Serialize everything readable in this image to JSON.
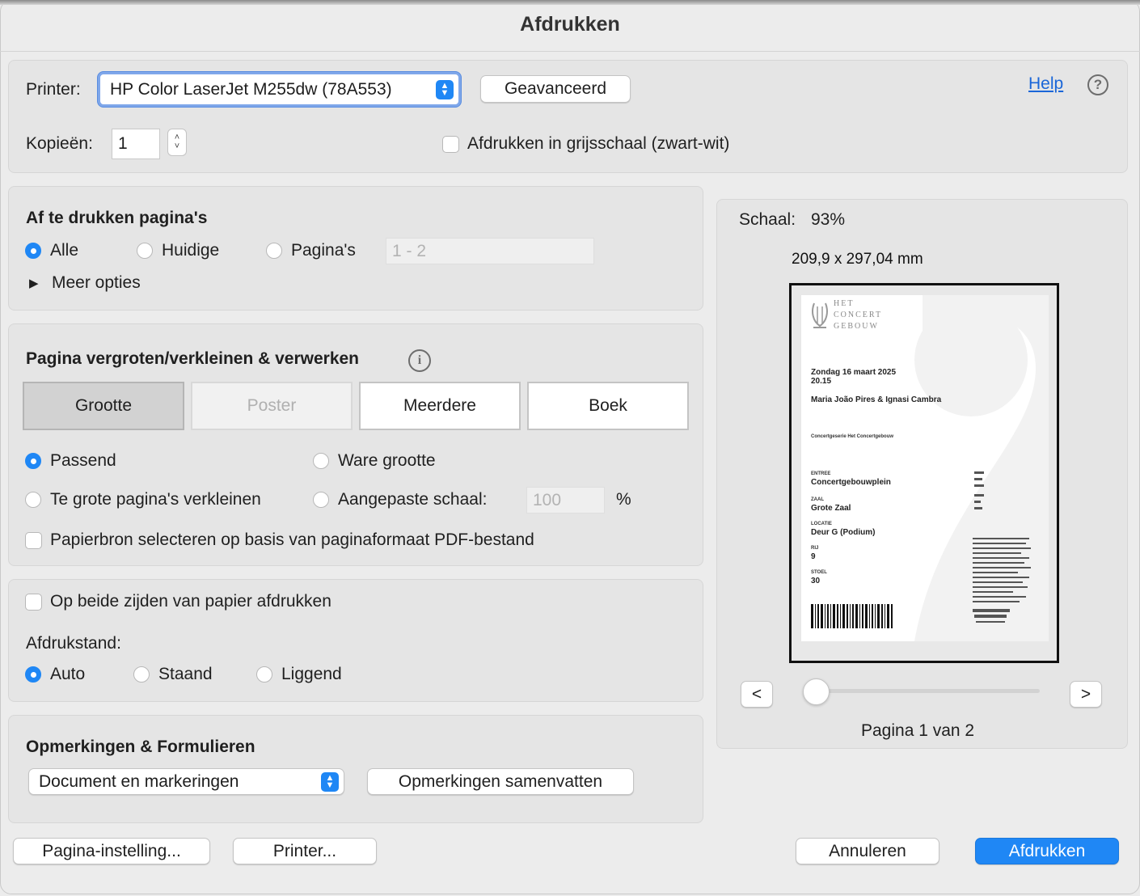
{
  "window": {
    "title": "Afdrukken"
  },
  "printer": {
    "label": "Printer:",
    "selected": "HP Color LaserJet M255dw (78A553)",
    "advanced_button": "Geavanceerd",
    "help_link": "Help",
    "help_icon": "?"
  },
  "copies": {
    "label": "Kopieën:",
    "value": "1",
    "grayscale_label": "Afdrukken in grijsschaal (zwart-wit)",
    "grayscale_checked": false
  },
  "pages": {
    "heading": "Af te drukken pagina's",
    "options": [
      "Alle",
      "Huidige",
      "Pagina's"
    ],
    "selected": "Alle",
    "range_placeholder": "1 - 2",
    "more_options": "Meer opties"
  },
  "sizing": {
    "heading": "Pagina vergroten/verkleinen & verwerken",
    "tabs": [
      "Grootte",
      "Poster",
      "Meerdere",
      "Boek"
    ],
    "active_tab": "Grootte",
    "disabled_tab": "Poster",
    "fit_label": "Passend",
    "actual_size_label": "Ware grootte",
    "shrink_label": "Te grote pagina's verkleinen",
    "custom_scale_label": "Aangepaste schaal:",
    "custom_scale_value": "100",
    "percent_symbol": "%",
    "selected": "Passend",
    "paper_source_label": "Papierbron selecteren op basis van paginaformaat PDF-bestand",
    "paper_source_checked": false
  },
  "duplex": {
    "label": "Op beide zijden van papier afdrukken",
    "checked": false,
    "orientation_label": "Afdrukstand:",
    "orientation_options": [
      "Auto",
      "Staand",
      "Liggend"
    ],
    "orientation_selected": "Auto"
  },
  "comments": {
    "heading": "Opmerkingen & Formulieren",
    "selected": "Document en markeringen",
    "summarize_button": "Opmerkingen samenvatten"
  },
  "preview": {
    "scale_label": "Schaal:",
    "scale_value": "93%",
    "dimensions": "209,9 x 297,04 mm",
    "prev_button": "<",
    "next_button": ">",
    "page_indicator": "Pagina 1 van 2",
    "page_slider_fraction": 0.0,
    "ticket": {
      "logo_lines": [
        "HET",
        "CONCERT",
        "GEBOUW"
      ],
      "date": "Zondag 16 maart 2025",
      "time": "20.15",
      "performers": "Maria João Pires & Ignasi Cambra",
      "series": "Concertgeserie Het Concertgebouw",
      "entry_label": "ENTREE",
      "entry_value": "Concertgebouwplein",
      "hall_label": "ZAAL",
      "hall_value": "Grote Zaal",
      "box_label": "LOCATIE",
      "box_value": "Deur G (Podium)",
      "row_label": "RIJ",
      "row_value": "9",
      "seat_label": "STOEL",
      "seat_value": "30"
    }
  },
  "footer": {
    "page_setup_button": "Pagina-instelling...",
    "printer_button": "Printer...",
    "cancel_button": "Annuleren",
    "print_button": "Afdrukken"
  },
  "colors": {
    "accent": "#1f87f5",
    "link": "#1a66d8",
    "panel": "#e5e5e5",
    "background": "#ececec"
  }
}
